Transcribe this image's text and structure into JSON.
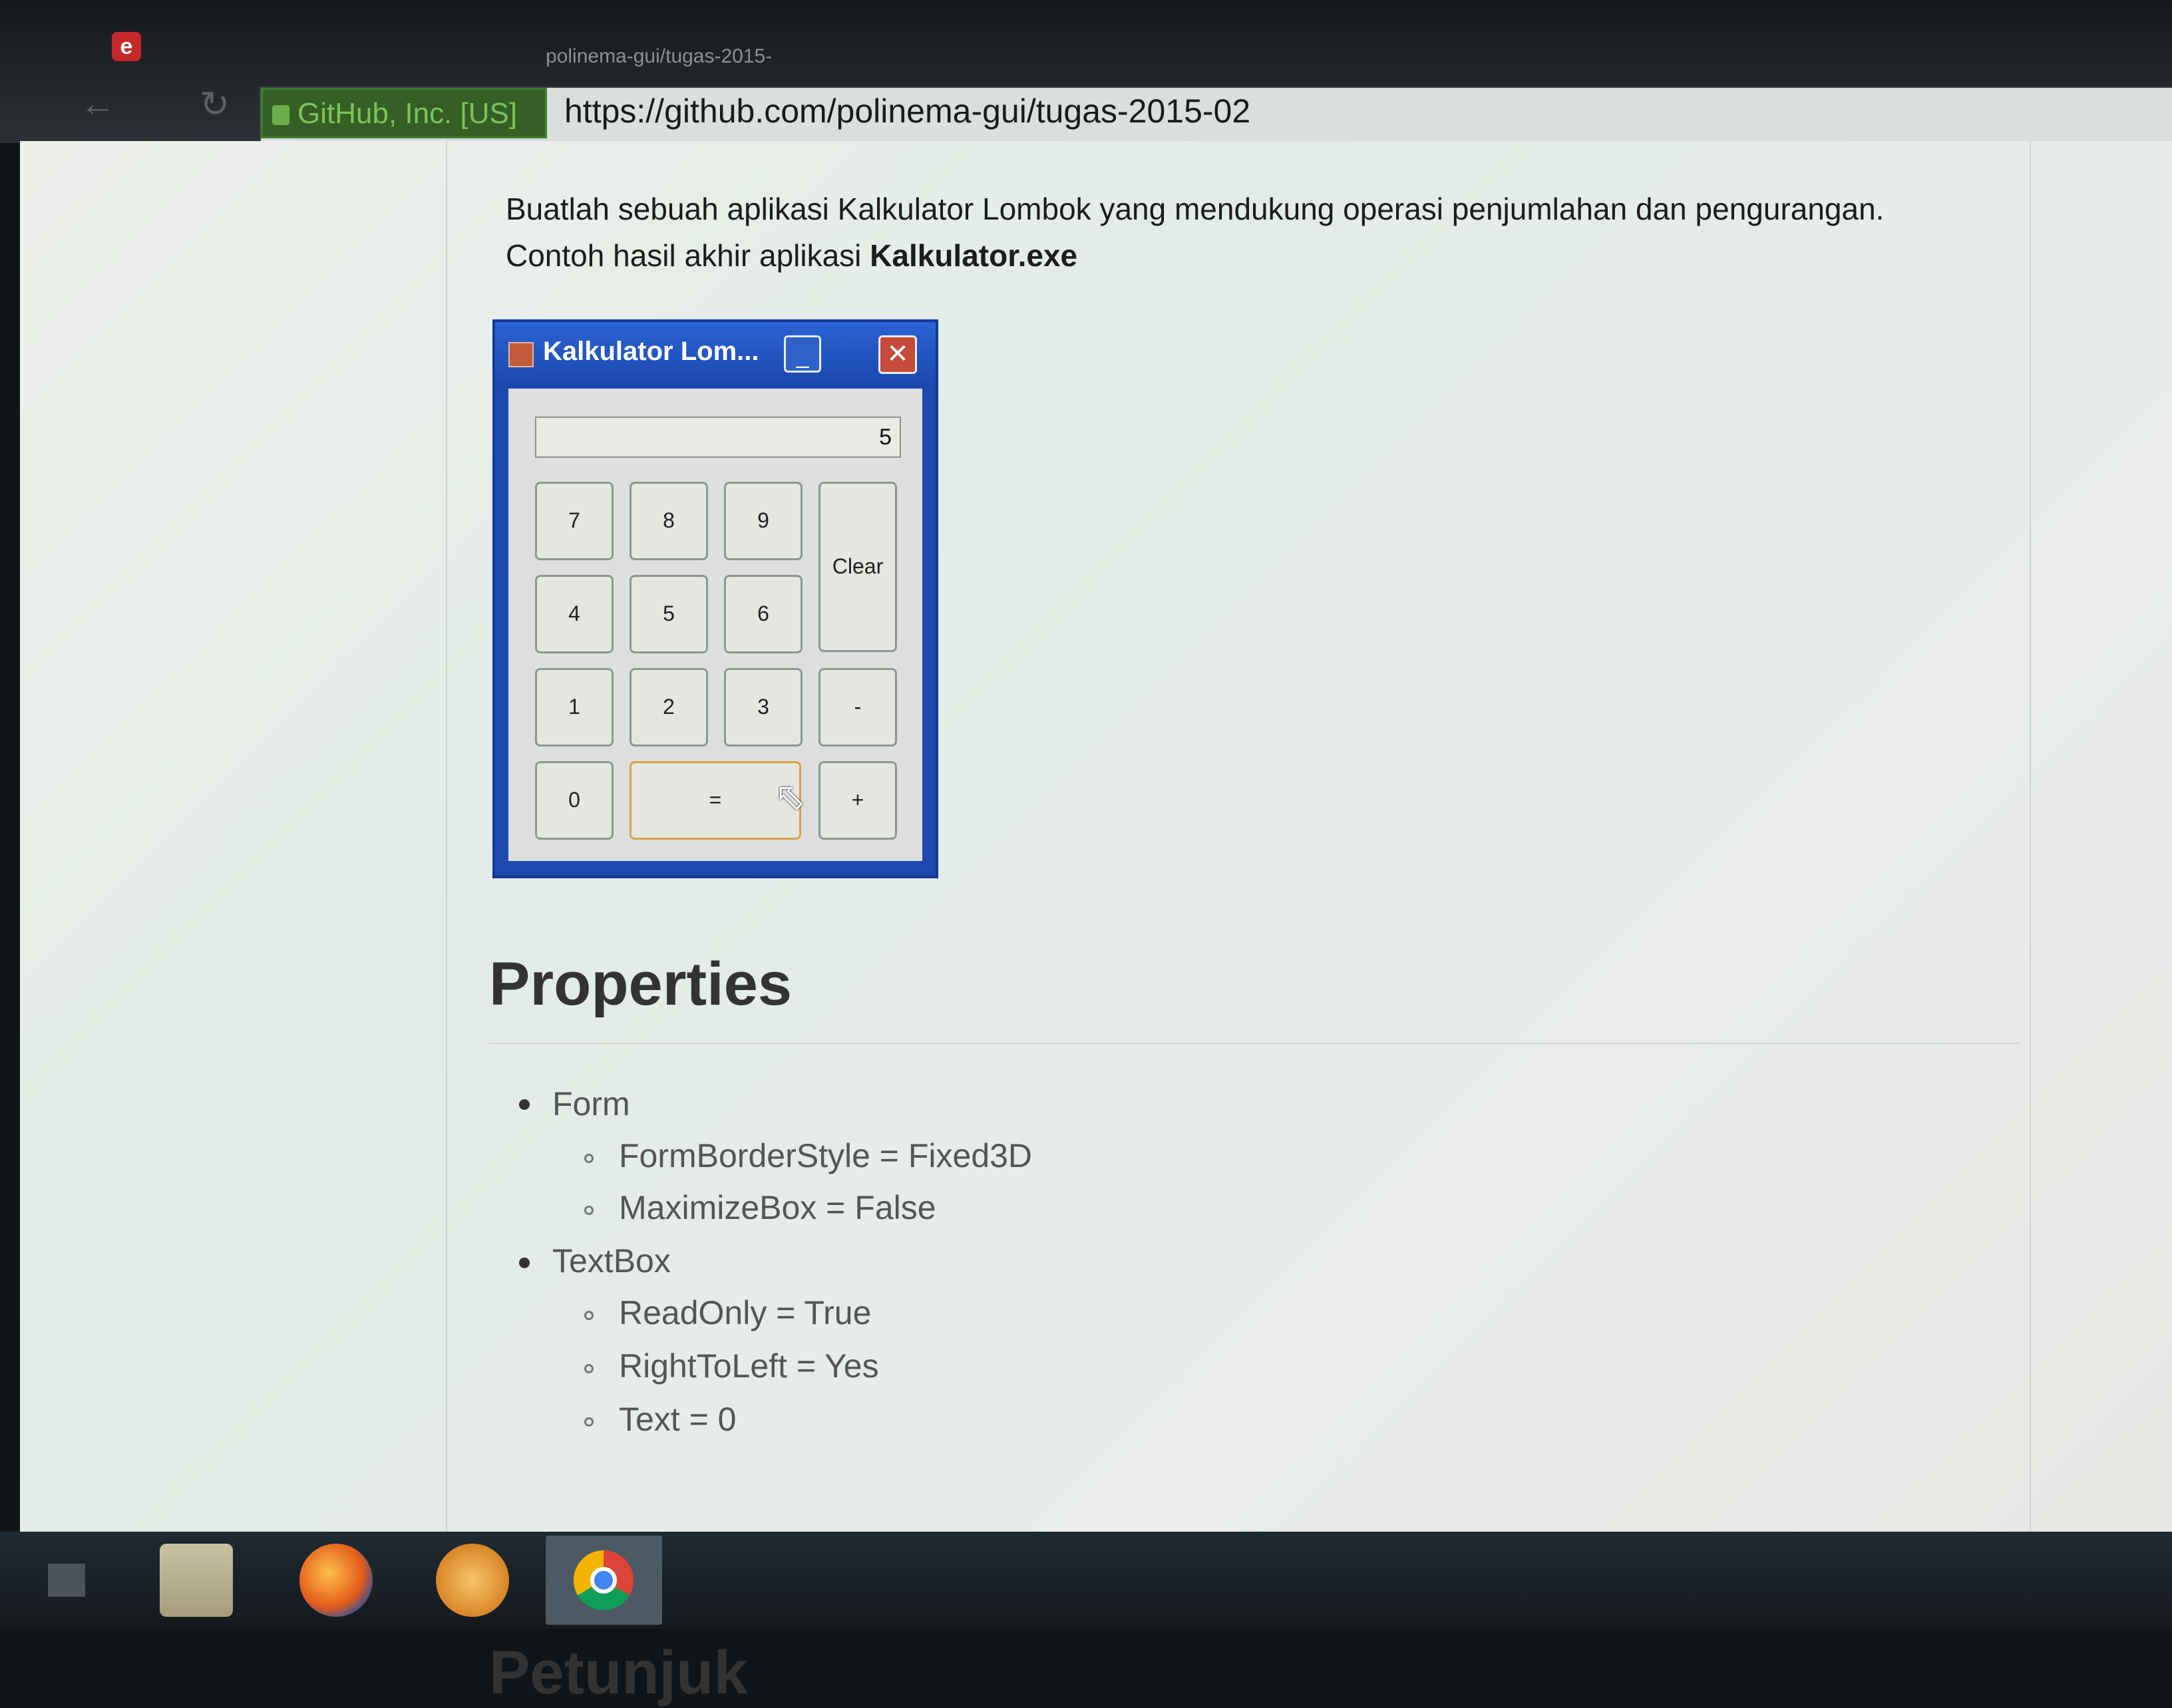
{
  "browser": {
    "tab_title": "polinema-gui/tugas-2015-",
    "tab_favicon": "e",
    "back_icon": "arrow-left",
    "reload_icon": "reload",
    "security_label": "GitHub, Inc. [US]",
    "url": "https://github.com/polinema-gui/tugas-2015-02"
  },
  "content": {
    "intro_line1": "Buatlah sebuah aplikasi Kalkulator Lombok yang mendukung operasi penjumlahan dan pengurangan.",
    "intro_line2_prefix": "Contoh hasil akhir aplikasi ",
    "intro_line2_bold": "Kalkulator.exe",
    "properties_heading": "Properties",
    "next_heading_partial": "Petunjuk",
    "properties": [
      {
        "label": "Form",
        "children": [
          "FormBorderStyle = Fixed3D",
          "MaximizeBox = False"
        ]
      },
      {
        "label": "TextBox",
        "children": [
          "ReadOnly = True",
          "RightToLeft = Yes",
          "Text = 0"
        ]
      }
    ]
  },
  "calculator": {
    "title": "Kalkulator Lom...",
    "minimize_glyph": "_",
    "close_glyph": "✕",
    "display_value": "5",
    "buttons": {
      "b7": "7",
      "b8": "8",
      "b9": "9",
      "clear": "Clear",
      "b4": "4",
      "b5": "5",
      "b6": "6",
      "b1": "1",
      "b2": "2",
      "b3": "3",
      "minus": "-",
      "b0": "0",
      "equals": "=",
      "plus": "+"
    }
  },
  "taskbar": {
    "items": [
      "start-icon",
      "file-manager-icon",
      "firefox-icon",
      "ubuntu-icon",
      "chrome-icon"
    ]
  }
}
